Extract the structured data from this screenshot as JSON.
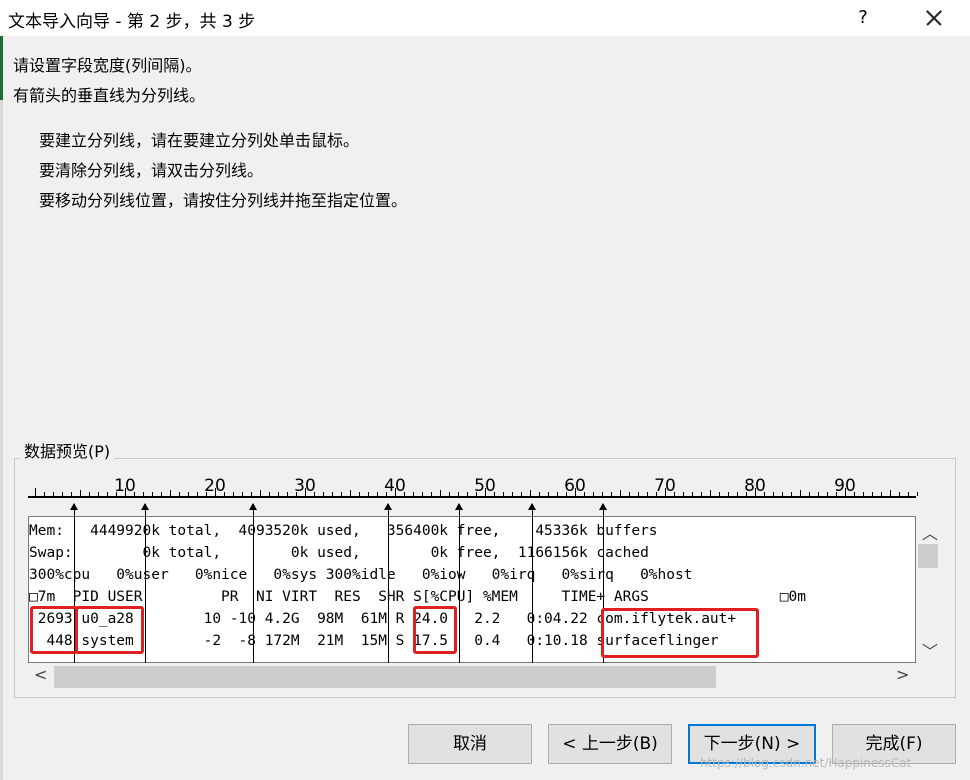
{
  "window": {
    "title": "文本导入向导 - 第 2 步，共 3 步",
    "help_label": "?"
  },
  "intro": {
    "line1": "请设置字段宽度(列间隔)。",
    "line2": "有箭头的垂直线为分列线。"
  },
  "instructions": {
    "line1": "要建立分列线，请在要建立分列处单击鼠标。",
    "line2": "要清除分列线，请双击分列线。",
    "line3": "要移动分列线位置，请按住分列线并拖至指定位置。"
  },
  "preview": {
    "label": "数据预览(P)",
    "ruler_numbers": [
      "10",
      "20",
      "30",
      "40",
      "50",
      "60",
      "70",
      "80",
      "90"
    ],
    "rows": [
      "Mem:   4449920k total,  4093520k used,   356400k free,    45336k buffers",
      "Swap:        0k total,        0k used,        0k free,  1166156k cached",
      "300%cpu   0%user   0%nice   0%sys 300%idle   0%iow   0%irq   0%sirq   0%host",
      "□7m  PID USER         PR  NI VIRT  RES  SHR S[%CPU] %MEM     TIME+ ARGS               □0m",
      " 2693 u0_a28        10 -10 4.2G  98M  61M R 24.0   2.2   0:04.22 com.iflytek.aut+",
      "  448 system        -2  -8 172M  21M  15M S 17.5   0.4   0:10.18 surfaceflinger"
    ]
  },
  "buttons": {
    "cancel": "取消",
    "back": "< 上一步(B)",
    "next": "下一步(N) >",
    "finish": "完成(F)"
  },
  "watermark": "https://blog.csdn.net/HappinessCat"
}
